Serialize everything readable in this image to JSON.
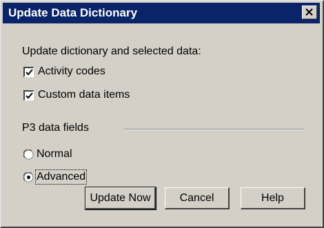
{
  "dialog": {
    "title": "Update Data Dictionary",
    "close_icon": "close-icon"
  },
  "update_section": {
    "heading": "Update dictionary and selected data:",
    "checkboxes": [
      {
        "label": "Activity codes",
        "checked": true
      },
      {
        "label": "Custom data items",
        "checked": true
      }
    ]
  },
  "p3_fields": {
    "group_label": "P3 data fields",
    "options": [
      {
        "label": "Normal",
        "selected": false
      },
      {
        "label": "Advanced",
        "selected": true
      }
    ]
  },
  "buttons": {
    "update_now": "Update Now",
    "cancel": "Cancel",
    "help": "Help"
  },
  "colors": {
    "titlebar": "#0a246a",
    "dialog_bg": "#d4d0c8"
  }
}
